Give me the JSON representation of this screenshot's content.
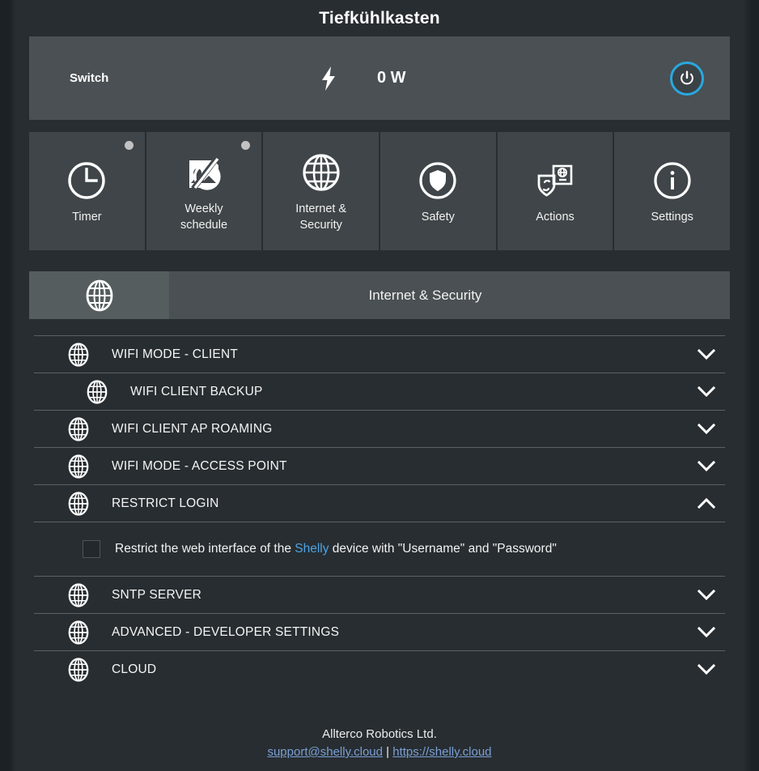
{
  "header": {
    "device_title": "Tiefkühlkasten"
  },
  "switch_bar": {
    "name": "Switch",
    "bolt_icon": "lightning-bolt-icon",
    "power_value": "0 W",
    "power_button_icon": "power-icon",
    "accent_color": "#29a8e0"
  },
  "tiles": [
    {
      "label": "Timer",
      "icon": "clock-icon",
      "dot": true
    },
    {
      "label": "Weekly\nschedule",
      "label_line1": "Weekly",
      "label_line2": "schedule",
      "icon": "schedule-disabled-icon",
      "dot": true
    },
    {
      "label_line1": "Internet &",
      "label_line2": "Security",
      "icon": "globe-icon",
      "dot": false
    },
    {
      "label_line1": "Safety",
      "label_line2": "",
      "icon": "shield-icon",
      "dot": false
    },
    {
      "label_line1": "Actions",
      "label_line2": "",
      "icon": "actions-icon",
      "dot": false
    },
    {
      "label_line1": "Settings",
      "label_line2": "",
      "icon": "info-icon",
      "dot": false
    }
  ],
  "section": {
    "icon": "globe-icon",
    "title": "Internet & Security"
  },
  "accordion": [
    {
      "label": "WIFI MODE - CLIENT",
      "icon": "globe-icon",
      "chevron": "chevron-down-icon",
      "expanded": false,
      "indent": false
    },
    {
      "label": "WIFI CLIENT BACKUP",
      "icon": "globe-icon",
      "chevron": "chevron-down-icon",
      "expanded": false,
      "indent": true
    },
    {
      "label": "WIFI CLIENT AP ROAMING",
      "icon": "globe-icon",
      "chevron": "chevron-down-icon",
      "expanded": false,
      "indent": false
    },
    {
      "label": "WIFI MODE - ACCESS POINT",
      "icon": "globe-icon",
      "chevron": "chevron-down-icon",
      "expanded": false,
      "indent": false
    },
    {
      "label": "RESTRICT LOGIN",
      "icon": "globe-icon",
      "chevron": "chevron-up-icon",
      "expanded": true,
      "indent": false
    },
    {
      "label": "SNTP SERVER",
      "icon": "globe-icon",
      "chevron": "chevron-down-icon",
      "expanded": false,
      "indent": false
    },
    {
      "label": "ADVANCED - DEVELOPER SETTINGS",
      "icon": "globe-icon",
      "chevron": "chevron-down-icon",
      "expanded": false,
      "indent": false
    },
    {
      "label": "CLOUD",
      "icon": "globe-icon",
      "chevron": "chevron-down-icon",
      "expanded": false,
      "indent": false
    }
  ],
  "restrict_login": {
    "checked": false,
    "text_before": "Restrict the web interface of the ",
    "brand": "Shelly",
    "text_after": " device with \"Username\" and \"Password\"",
    "brand_color": "#4fa3e3"
  },
  "footer": {
    "company": "Allterco Robotics Ltd.",
    "email": "support@shelly.cloud",
    "separator": " | ",
    "website": "https://shelly.cloud"
  }
}
